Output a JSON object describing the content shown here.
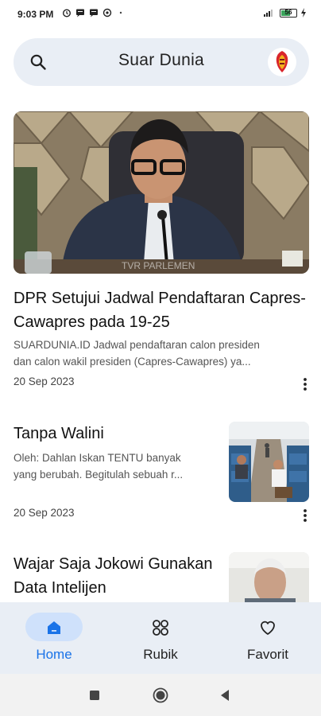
{
  "status_bar": {
    "time": "9:03 PM",
    "battery": "56"
  },
  "search": {
    "title": "Suar Dunia"
  },
  "featured": {
    "title": "DPR Setujui Jadwal Pendaftaran Capres-Cawapres pada 19-25",
    "excerpt_line1": "SUARDUNIA.ID Jadwal pendaftaran calon presiden",
    "excerpt_line2": "dan calon wakil presiden (Capres-Cawapres) ya...",
    "date": "20 Sep 2023",
    "watermark": "TVR PARLEMEN"
  },
  "articles": [
    {
      "title": "Tanpa Walini",
      "excerpt_line1": "Oleh: Dahlan Iskan TENTU banyak",
      "excerpt_line2": "yang berubah. Begitulah sebuah r...",
      "date": "20 Sep 2023"
    },
    {
      "title": "Wajar Saja Jokowi Gunakan Data Intelijen"
    }
  ],
  "bottom_nav": {
    "items": [
      {
        "label": "Home",
        "icon": "home-icon",
        "active": true
      },
      {
        "label": "Rubik",
        "icon": "grid-icon",
        "active": false
      },
      {
        "label": "Favorit",
        "icon": "heart-icon",
        "active": false
      }
    ]
  },
  "colors": {
    "accent": "#1a73e8",
    "active_pill": "#cfe1fb",
    "surface": "#e9eef5"
  }
}
